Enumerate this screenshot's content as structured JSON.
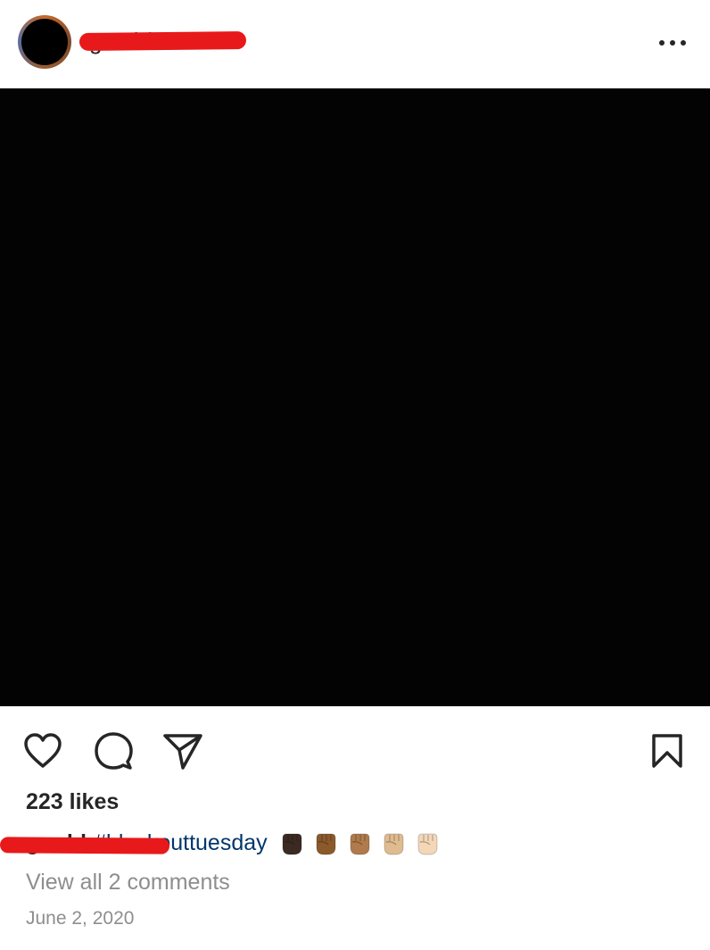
{
  "post": {
    "username": "g...rld",
    "caption_user": "g...rld",
    "hashtag": "#blackouttuesday",
    "fist_emojis": [
      {
        "name": "fist-dark-icon",
        "color": "#3b2a22"
      },
      {
        "name": "fist-medium-dark-icon",
        "color": "#8b5a2b"
      },
      {
        "name": "fist-medium-icon",
        "color": "#b07a4c"
      },
      {
        "name": "fist-medium-light-icon",
        "color": "#e0bb8f"
      },
      {
        "name": "fist-light-icon",
        "color": "#f3d7b7"
      }
    ],
    "likes": "223 likes",
    "view_comments": "View all 2 comments",
    "date": "June 2, 2020"
  },
  "colors": {
    "redaction": "#e8191a",
    "hashtag": "#00376b",
    "muted_text": "#8e8e8e",
    "media_background": "#030303"
  },
  "icons": {
    "more": "more-options-icon",
    "like": "heart-icon",
    "comment": "comment-icon",
    "share": "send-icon",
    "save": "bookmark-icon"
  }
}
